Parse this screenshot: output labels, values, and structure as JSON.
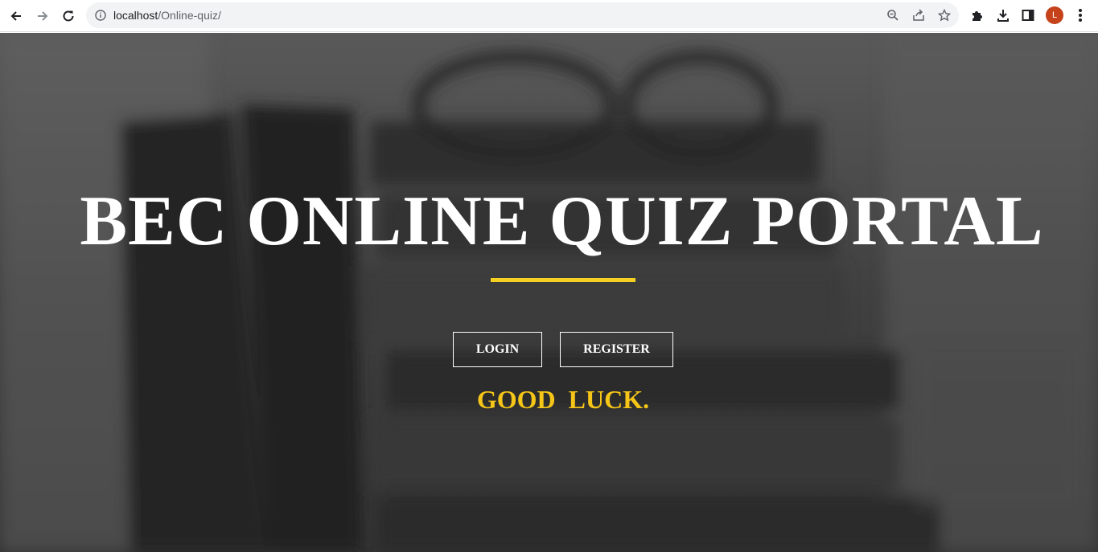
{
  "browser": {
    "url_host": "localhost",
    "url_path": "/Online-quiz/",
    "profile_initial": "L"
  },
  "hero": {
    "title": "BEC ONLINE QUIZ PORTAL",
    "login_label": "LOGIN",
    "register_label": "REGISTER",
    "tagline": "GOOD  LUCK."
  },
  "colors": {
    "accent": "#f5d020",
    "tagline": "#f5c518",
    "avatar": "#c5421a"
  }
}
